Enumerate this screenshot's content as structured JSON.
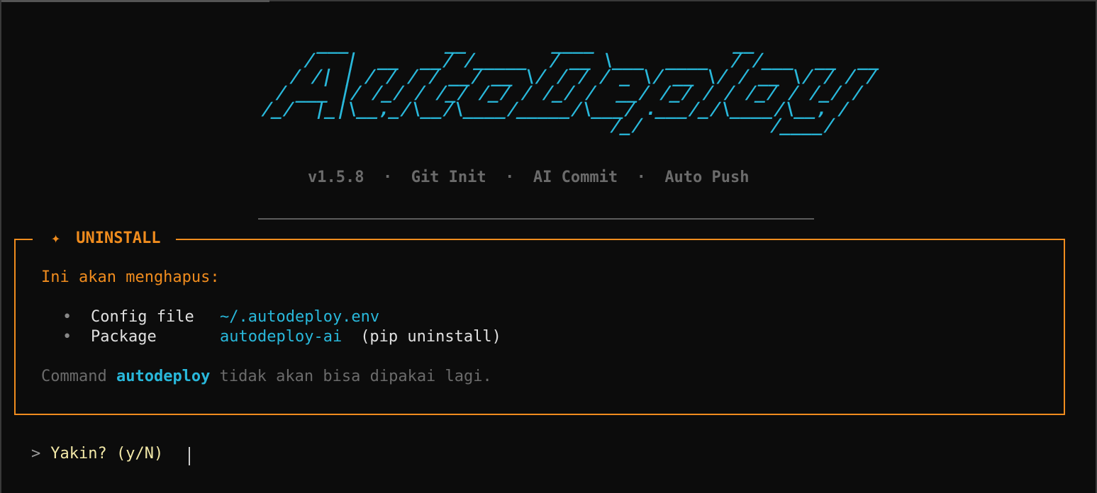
{
  "banner": {
    "ascii": "    ___         __        ____             __\n   /   |  __  __/ /_____  / __ \\___  ____  / /___  __  __\n  / /| | / / / / __/ __ \\/ / / / _ \\/ __ \\/ / __ \\/ / / /\n / ___ |/ /_/ / /_/ /_/ / /_/ /  __/ /_/ / / /_/ / /_/ /\n/_/  |_|\\__,_/\\__/\\____/_____/\\___/ .___/_/\\____/\\__, /\n                                 /_/            /____/",
    "subtitle": "v1.5.8  ·  Git Init  ·  AI Commit  ·  Auto Push"
  },
  "panel": {
    "star": "✦",
    "title": "UNINSTALL",
    "warning": "Ini akan menghapus:",
    "items": [
      {
        "bullet": "•",
        "label": "Config file",
        "value": "~/.autodeploy.env",
        "note": ""
      },
      {
        "bullet": "•",
        "label": "Package",
        "value": "autodeploy-ai",
        "note": "(pip uninstall)"
      }
    ],
    "note_prefix": "Command ",
    "note_cmd": "autodeploy",
    "note_suffix": " tidak akan bisa dipakai lagi."
  },
  "prompt": {
    "arrow": ">",
    "question": "Yakin? (y/N)"
  },
  "colors": {
    "background": "#0c0c0c",
    "accent_cyan": "#29b8db",
    "accent_orange": "#f08c1e",
    "muted": "#6b6b6b",
    "prompt_yellow": "#f3e9a8"
  }
}
